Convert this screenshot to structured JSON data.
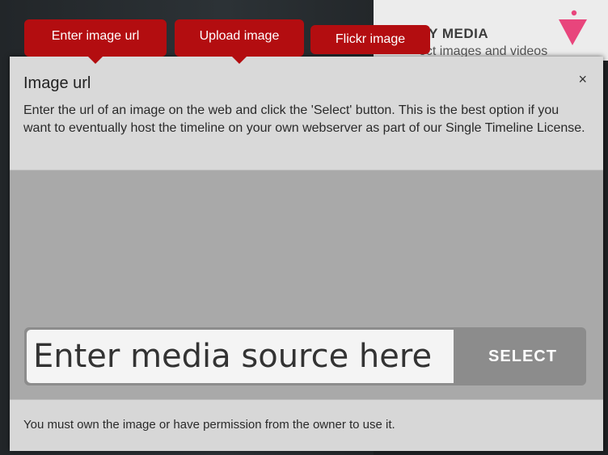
{
  "background": {
    "heading": "RY MEDIA",
    "subtext": "ect images and videos"
  },
  "tabs": [
    {
      "label": "Enter image url"
    },
    {
      "label": "Upload image"
    },
    {
      "label": "Flickr image"
    }
  ],
  "dialog": {
    "title": "Image url",
    "close_label": "×",
    "description": "Enter the url of an image on the web and click the 'Select' button. This is the best option if you want to eventually host the timeline on your own webserver as part of our Single Timeline License.",
    "input_placeholder": "Enter media source here",
    "select_label": "SELECT",
    "footer": "You must own the image or have permission from the owner to use it."
  },
  "colors": {
    "tab_red": "#b30d10",
    "pointer_pink": "#e8457c"
  }
}
